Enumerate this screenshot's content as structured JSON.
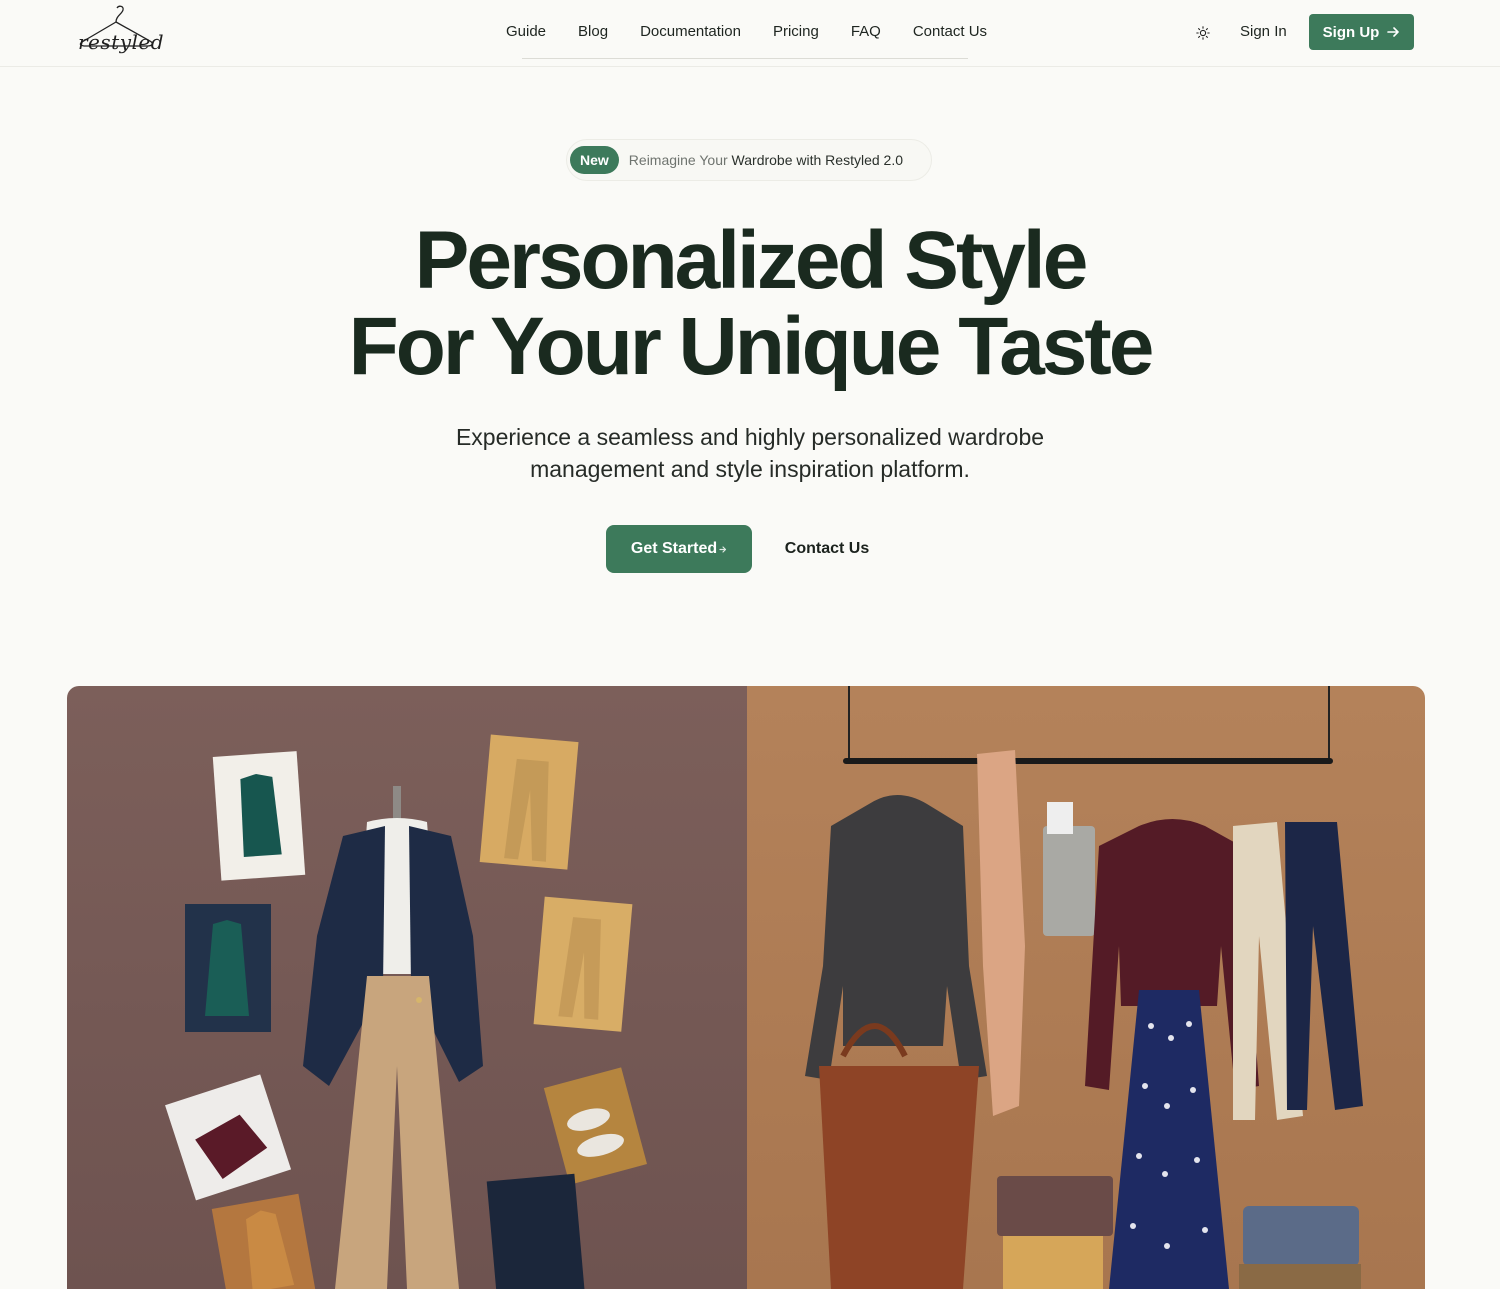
{
  "brand": {
    "logo_text": "restyled"
  },
  "nav": {
    "items": [
      {
        "label": "Guide"
      },
      {
        "label": "Blog"
      },
      {
        "label": "Documentation"
      },
      {
        "label": "Pricing"
      },
      {
        "label": "FAQ"
      },
      {
        "label": "Contact Us"
      }
    ]
  },
  "header_actions": {
    "theme_icon": "sun-icon",
    "sign_in": "Sign In",
    "sign_up": "Sign Up",
    "sign_up_icon": "arrow-right-icon"
  },
  "announcement": {
    "badge": "New",
    "text_prefix": "Reimagine Your ",
    "text_emphasis": "Wardrobe with Restyled 2.0"
  },
  "hero": {
    "title_line1": "Personalized Style",
    "title_line2": "For Your Unique Taste",
    "subtitle_line1": "Experience a seamless and highly personalized wardrobe",
    "subtitle_line2": "management and style inspiration platform.",
    "primary_cta": "Get Started",
    "secondary_cta": "Contact Us"
  },
  "colors": {
    "accent": "#3d7a5b",
    "background": "#fafaf7",
    "headline": "#1a2a1f"
  }
}
